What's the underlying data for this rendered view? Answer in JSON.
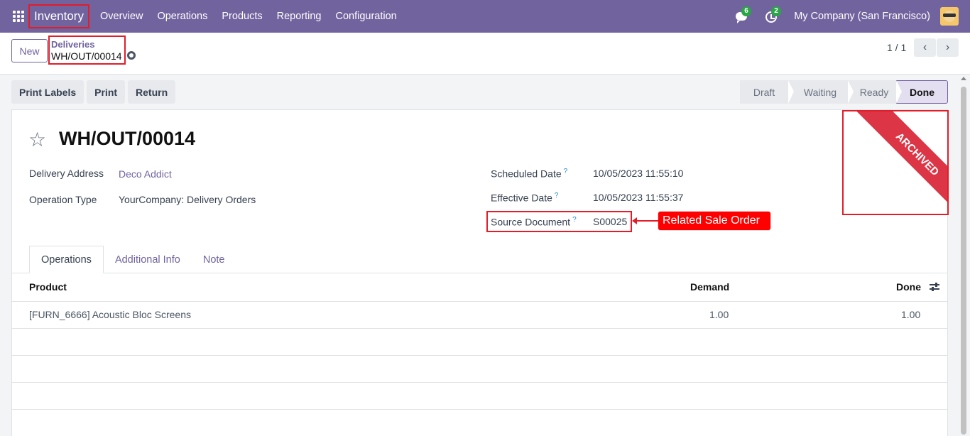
{
  "navbar": {
    "app_name": "Inventory",
    "menu": [
      "Overview",
      "Operations",
      "Products",
      "Reporting",
      "Configuration"
    ],
    "messages_count": "6",
    "activities_count": "2",
    "company": "My Company (San Francisco)"
  },
  "control": {
    "new_label": "New",
    "breadcrumb_parent": "Deliveries",
    "breadcrumb_current": "WH/OUT/00014",
    "pager": "1 / 1"
  },
  "actions": [
    "Print Labels",
    "Print",
    "Return"
  ],
  "status": {
    "stages": [
      "Draft",
      "Waiting",
      "Ready",
      "Done"
    ],
    "current": "Done"
  },
  "form": {
    "title": "WH/OUT/00014",
    "ribbon": "ARCHIVED",
    "delivery_address_label": "Delivery Address",
    "delivery_address_value": "Deco Addict",
    "operation_type_label": "Operation Type",
    "operation_type_value": "YourCompany: Delivery Orders",
    "scheduled_date_label": "Scheduled Date",
    "scheduled_date_value": "10/05/2023 11:55:10",
    "effective_date_label": "Effective Date",
    "effective_date_value": "10/05/2023 11:55:37",
    "source_document_label": "Source Document",
    "source_document_value": "S00025",
    "help_mark": "?",
    "annotation": "Related Sale Order"
  },
  "tabs": [
    "Operations",
    "Additional Info",
    "Note"
  ],
  "table": {
    "headers": {
      "product": "Product",
      "demand": "Demand",
      "done": "Done"
    },
    "rows": [
      {
        "product": "[FURN_6666] Acoustic Bloc Screens",
        "demand": "1.00",
        "done": "1.00"
      }
    ]
  },
  "colors": {
    "brand": "#71639e",
    "annotation_red": "#e11d2a",
    "ribbon": "#dc3545",
    "badge_green": "#28a745"
  }
}
